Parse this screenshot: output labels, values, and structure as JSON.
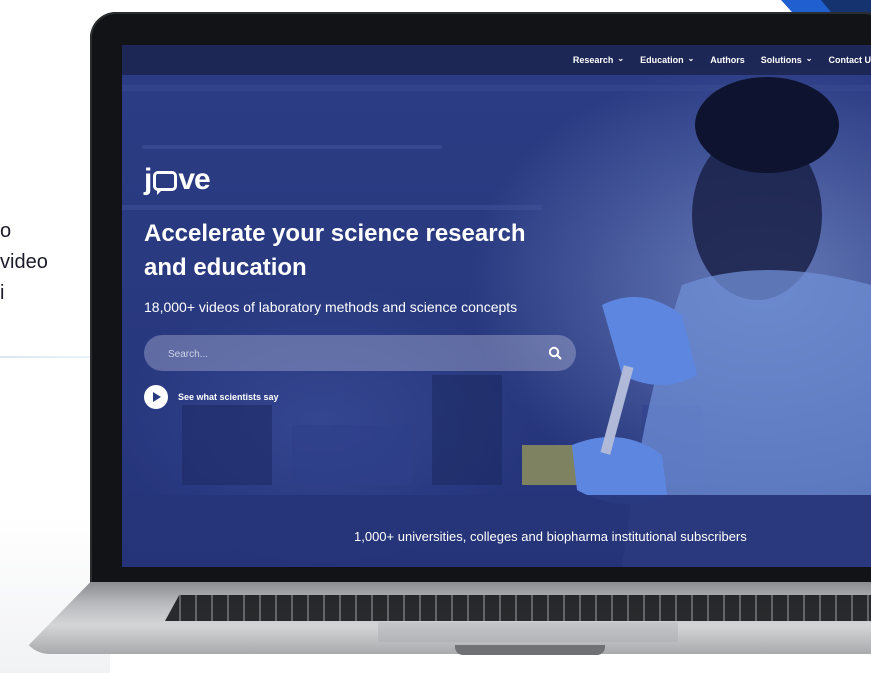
{
  "left_fragment": {
    "lines": [
      "o",
      "video",
      "i"
    ]
  },
  "nav": {
    "items": [
      {
        "label": "Research",
        "dropdown": true
      },
      {
        "label": "Education",
        "dropdown": true
      },
      {
        "label": "Authors",
        "dropdown": false
      },
      {
        "label": "Solutions",
        "dropdown": true
      },
      {
        "label": "Contact U",
        "dropdown": false
      }
    ]
  },
  "hero": {
    "logo_prefix": "j",
    "logo_suffix": "ve",
    "headline": "Accelerate your science research and education",
    "subhead": "18,000+ videos of laboratory methods and science concepts",
    "search_placeholder": "Search...",
    "watch_label": "See what scientists say"
  },
  "band": {
    "text": "1,000+ universities, colleges and biopharma institutional subscribers"
  },
  "colors": {
    "screen_bg": "#2a3a80",
    "accent_corner": "#1f5fd0"
  }
}
